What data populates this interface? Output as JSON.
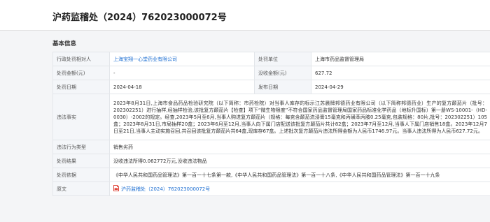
{
  "page": {
    "title": "沪药监稽处（2024）762023000072号"
  },
  "section": {
    "title": "基本信息"
  },
  "fields": {
    "admin_party_label": "行政处罚相对人",
    "admin_party_value": "上海宝翔一心堂药业有限公司",
    "penalty_unit_label": "处罚单位",
    "penalty_unit_value": "上海市药品监督管理局",
    "penalty_amount_label": "处罚金额(元)",
    "penalty_amount_value": "-",
    "confiscated_amount_label": "没收金额(元)",
    "confiscated_amount_value": "627.72",
    "penalty_date_label": "处罚日期",
    "penalty_date_value": "2024-04-18",
    "publish_date_label": "发布日期",
    "publish_date_value": "2024-04-29",
    "facts_label": "违法事实",
    "facts_value": "2023年8月31日,上海市食品药品检验研究院（以下简称：市药检院）对当事人库存的标示江苏晨牌邦德药业有限公司（以下简称邦德药业）生产的复方颠茄片（批号：202302251）进行抽样,经抽样检验,该批复方颠茄片【检查】项下“微生物限度”不符合国家药品监督管理局国家药品标准化学药品（地标升国标）第一册WS-10001-（HD-0030）-2002的规定。经查,2023年5月至6月,当事人购进复方颠茄片（规格：每克含颠茄流浸膏15毫克和丙磺苯丙胺0.25毫克,包装规格：80片,批号：202302251）105盒；2023年8月31日,市局抽样20盒；2023年6月至12月,当事人向下属门店配送该批复方颠茄片共计82盒；2023年7月至12月,当事人下属门店销售18盒。2023年12月7日至21日,当事人主动实施召回,共召回该批复方颠茄片共64盒,现库存67盒。上述批次复方颠茄片违法所得金额为人民币1746.97元。当事人违法所得为人民币627.72元。",
    "violation_type_label": "违法行为类型",
    "violation_type_value": "销售劣药",
    "result_label": "处罚结果",
    "result_value": "没收违法所得0.062772万元,没收违法物品",
    "basis_label": "处罚依据",
    "basis_value": "《中华人民共和国药品管理法》第一百一十七条第一款,《中华人民共和国药品管理法》第一百一十八条,《中华人民共和国药品管理法》第一百一十九条",
    "original_label": "原文",
    "original_value": "沪药监稽处（2024）762023000072号"
  },
  "icons": {
    "original_doc": "pdf-file-icon"
  },
  "colors": {
    "link": "#1e6fd2",
    "pdf_icon": "#e0463b",
    "label_bg": "#f4f6f9",
    "border": "#e3e6ea"
  }
}
